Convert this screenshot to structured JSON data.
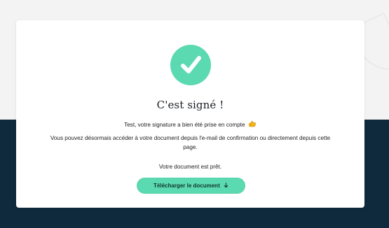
{
  "page": {
    "title": "C'est signé !",
    "message_line": "Test, votre signature a bien été prise en compte",
    "info_text": "Vous pouvez désormais accéder à votre document depuis l'e-mail de confirmation ou directement depuis cette page.",
    "ready_text": "Votre document est prêt.",
    "button_label": "Télécharger le document"
  },
  "icons": {
    "success": "check-circle-icon",
    "thumbs_up": "thumbs-up-icon",
    "download": "down-arrow-icon"
  },
  "colors": {
    "accent": "#5bd9b0",
    "dark_background": "#0f2a3d",
    "card_background": "#ffffff"
  }
}
